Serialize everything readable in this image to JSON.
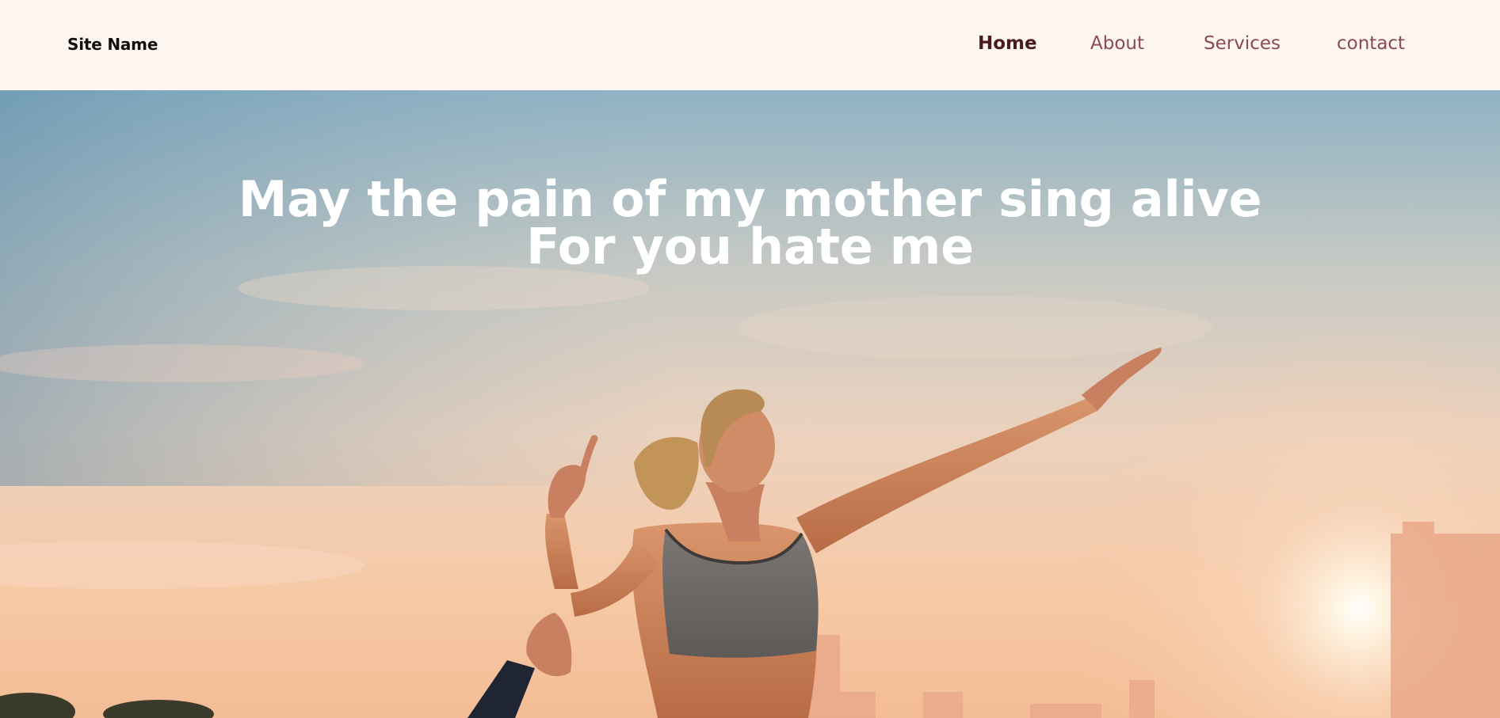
{
  "header": {
    "site_name": "Site Name",
    "nav": [
      {
        "label": "Home",
        "active": true
      },
      {
        "label": "About",
        "active": false
      },
      {
        "label": "Services",
        "active": false
      },
      {
        "label": "contact",
        "active": false
      }
    ]
  },
  "hero": {
    "headline_line1": "May the pain of my mother sing alive",
    "headline_line2": "For you hate me",
    "image": "hero-photo-woman-yoga-pose-city-skyline-sunrise"
  },
  "colors": {
    "header_bg": "#fdf6f0",
    "nav_active": "#4a1a22",
    "nav_inactive": "#8a4a52",
    "headline": "#ffffff"
  }
}
